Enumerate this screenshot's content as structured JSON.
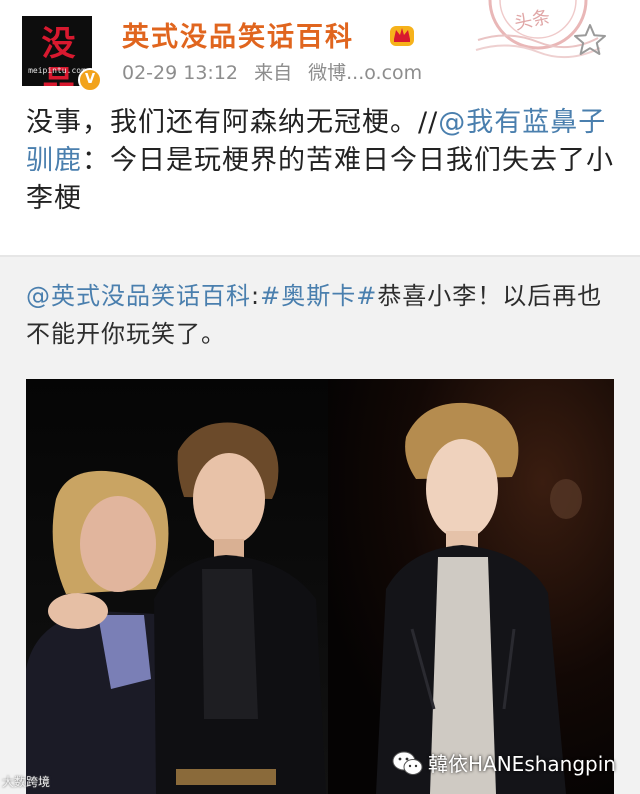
{
  "header": {
    "username": "英式没品笑话百科",
    "timestamp": "02-29 13:12",
    "source_prefix": "来自",
    "source": "微博...o.com",
    "avatar_logo_text": "没品",
    "avatar_url_text": "meipintu.com",
    "stamp_text": "头条",
    "verified_badge": "V",
    "icons": [
      "crown-icon",
      "star-icon",
      "verified-icon"
    ]
  },
  "post": {
    "text_before": "没事，我们还有阿森纳无冠梗。//",
    "mention": "@我有蓝鼻子驯鹿",
    "text_after": "：今日是玩梗界的苦难日今日我们失去了小李梗"
  },
  "retweet": {
    "mention": "@英式没品笑话百科",
    "colon": ":",
    "hashtag": "#奥斯卡#",
    "text": "恭喜小李！以后再也不能开你玩笑了。"
  },
  "watermarks": {
    "left": "大数跨境",
    "right": "韓依HANEshangpin"
  },
  "colors": {
    "username": "#e0651e",
    "link": "#4a7fae",
    "meta": "#8d8d8d",
    "verified": "#f2a31c",
    "retweet_bg": "#f2f2f2"
  }
}
